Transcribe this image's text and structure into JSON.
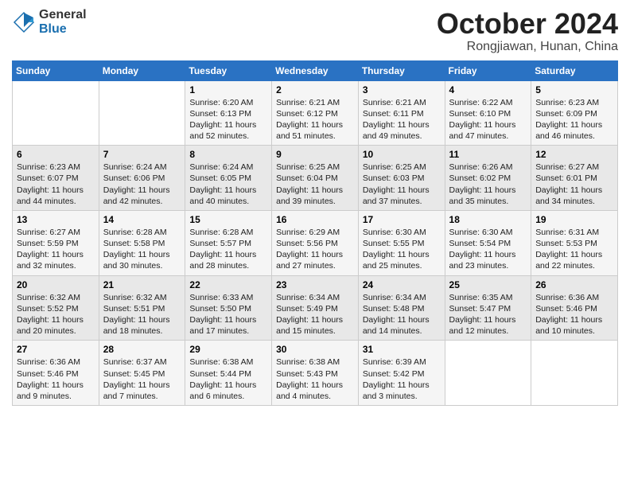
{
  "logo": {
    "general": "General",
    "blue": "Blue"
  },
  "title": "October 2024",
  "location": "Rongjiawan, Hunan, China",
  "weekdays": [
    "Sunday",
    "Monday",
    "Tuesday",
    "Wednesday",
    "Thursday",
    "Friday",
    "Saturday"
  ],
  "weeks": [
    [
      {
        "day": "",
        "text": ""
      },
      {
        "day": "",
        "text": ""
      },
      {
        "day": "1",
        "text": "Sunrise: 6:20 AM\nSunset: 6:13 PM\nDaylight: 11 hours and 52 minutes."
      },
      {
        "day": "2",
        "text": "Sunrise: 6:21 AM\nSunset: 6:12 PM\nDaylight: 11 hours and 51 minutes."
      },
      {
        "day": "3",
        "text": "Sunrise: 6:21 AM\nSunset: 6:11 PM\nDaylight: 11 hours and 49 minutes."
      },
      {
        "day": "4",
        "text": "Sunrise: 6:22 AM\nSunset: 6:10 PM\nDaylight: 11 hours and 47 minutes."
      },
      {
        "day": "5",
        "text": "Sunrise: 6:23 AM\nSunset: 6:09 PM\nDaylight: 11 hours and 46 minutes."
      }
    ],
    [
      {
        "day": "6",
        "text": "Sunrise: 6:23 AM\nSunset: 6:07 PM\nDaylight: 11 hours and 44 minutes."
      },
      {
        "day": "7",
        "text": "Sunrise: 6:24 AM\nSunset: 6:06 PM\nDaylight: 11 hours and 42 minutes."
      },
      {
        "day": "8",
        "text": "Sunrise: 6:24 AM\nSunset: 6:05 PM\nDaylight: 11 hours and 40 minutes."
      },
      {
        "day": "9",
        "text": "Sunrise: 6:25 AM\nSunset: 6:04 PM\nDaylight: 11 hours and 39 minutes."
      },
      {
        "day": "10",
        "text": "Sunrise: 6:25 AM\nSunset: 6:03 PM\nDaylight: 11 hours and 37 minutes."
      },
      {
        "day": "11",
        "text": "Sunrise: 6:26 AM\nSunset: 6:02 PM\nDaylight: 11 hours and 35 minutes."
      },
      {
        "day": "12",
        "text": "Sunrise: 6:27 AM\nSunset: 6:01 PM\nDaylight: 11 hours and 34 minutes."
      }
    ],
    [
      {
        "day": "13",
        "text": "Sunrise: 6:27 AM\nSunset: 5:59 PM\nDaylight: 11 hours and 32 minutes."
      },
      {
        "day": "14",
        "text": "Sunrise: 6:28 AM\nSunset: 5:58 PM\nDaylight: 11 hours and 30 minutes."
      },
      {
        "day": "15",
        "text": "Sunrise: 6:28 AM\nSunset: 5:57 PM\nDaylight: 11 hours and 28 minutes."
      },
      {
        "day": "16",
        "text": "Sunrise: 6:29 AM\nSunset: 5:56 PM\nDaylight: 11 hours and 27 minutes."
      },
      {
        "day": "17",
        "text": "Sunrise: 6:30 AM\nSunset: 5:55 PM\nDaylight: 11 hours and 25 minutes."
      },
      {
        "day": "18",
        "text": "Sunrise: 6:30 AM\nSunset: 5:54 PM\nDaylight: 11 hours and 23 minutes."
      },
      {
        "day": "19",
        "text": "Sunrise: 6:31 AM\nSunset: 5:53 PM\nDaylight: 11 hours and 22 minutes."
      }
    ],
    [
      {
        "day": "20",
        "text": "Sunrise: 6:32 AM\nSunset: 5:52 PM\nDaylight: 11 hours and 20 minutes."
      },
      {
        "day": "21",
        "text": "Sunrise: 6:32 AM\nSunset: 5:51 PM\nDaylight: 11 hours and 18 minutes."
      },
      {
        "day": "22",
        "text": "Sunrise: 6:33 AM\nSunset: 5:50 PM\nDaylight: 11 hours and 17 minutes."
      },
      {
        "day": "23",
        "text": "Sunrise: 6:34 AM\nSunset: 5:49 PM\nDaylight: 11 hours and 15 minutes."
      },
      {
        "day": "24",
        "text": "Sunrise: 6:34 AM\nSunset: 5:48 PM\nDaylight: 11 hours and 14 minutes."
      },
      {
        "day": "25",
        "text": "Sunrise: 6:35 AM\nSunset: 5:47 PM\nDaylight: 11 hours and 12 minutes."
      },
      {
        "day": "26",
        "text": "Sunrise: 6:36 AM\nSunset: 5:46 PM\nDaylight: 11 hours and 10 minutes."
      }
    ],
    [
      {
        "day": "27",
        "text": "Sunrise: 6:36 AM\nSunset: 5:46 PM\nDaylight: 11 hours and 9 minutes."
      },
      {
        "day": "28",
        "text": "Sunrise: 6:37 AM\nSunset: 5:45 PM\nDaylight: 11 hours and 7 minutes."
      },
      {
        "day": "29",
        "text": "Sunrise: 6:38 AM\nSunset: 5:44 PM\nDaylight: 11 hours and 6 minutes."
      },
      {
        "day": "30",
        "text": "Sunrise: 6:38 AM\nSunset: 5:43 PM\nDaylight: 11 hours and 4 minutes."
      },
      {
        "day": "31",
        "text": "Sunrise: 6:39 AM\nSunset: 5:42 PM\nDaylight: 11 hours and 3 minutes."
      },
      {
        "day": "",
        "text": ""
      },
      {
        "day": "",
        "text": ""
      }
    ]
  ]
}
